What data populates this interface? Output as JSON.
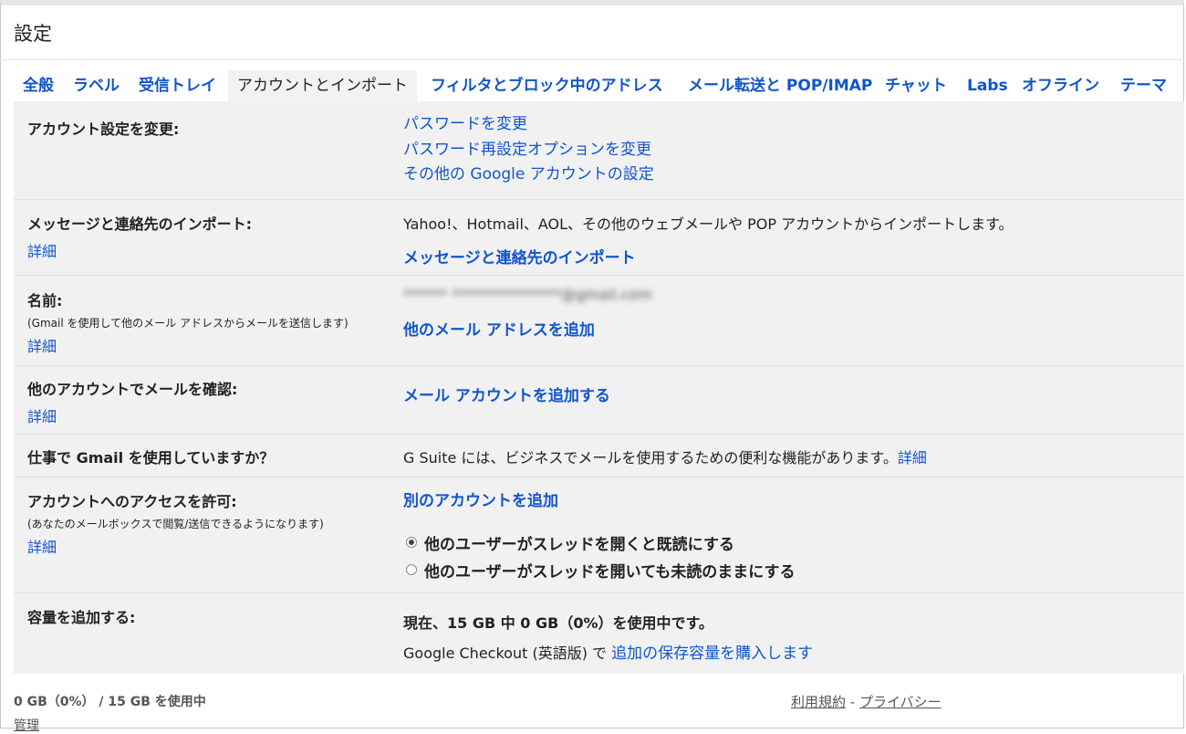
{
  "header": {
    "title": "設定"
  },
  "tabs": [
    {
      "label": "全般"
    },
    {
      "label": "ラベル"
    },
    {
      "label": "受信トレイ"
    },
    {
      "label": "アカウントとインポート",
      "active": true
    },
    {
      "label": "フィルタとブロック中のアドレス"
    },
    {
      "label": "メール転送と POP/IMAP"
    },
    {
      "label": "チャット"
    },
    {
      "label": "Labs"
    },
    {
      "label": "オフライン"
    },
    {
      "label": "テーマ"
    }
  ],
  "sections": {
    "account": {
      "label": "アカウント設定を変更:",
      "links": [
        "パスワードを変更",
        "パスワード再設定オプションを変更",
        "その他の Google アカウントの設定"
      ]
    },
    "import": {
      "label": "メッセージと連絡先のインポート:",
      "more": "詳細",
      "description": "Yahoo!、Hotmail、AOL、その他のウェブメールや POP アカウントからインポートします。",
      "action": "メッセージと連絡先のインポート"
    },
    "name": {
      "label": "名前:",
      "sub": "(Gmail を使用して他のメール アドレスからメールを送信します)",
      "more": "詳細",
      "value_blurred": "****** ***************@gmail.com",
      "action": "他のメール アドレスを追加"
    },
    "check_mail": {
      "label": "他のアカウントでメールを確認:",
      "more": "詳細",
      "action": "メール アカウントを追加する"
    },
    "work": {
      "label": "仕事で Gmail を使用していますか？",
      "description": "G Suite には、ビジネスでメールを使用するための便利な機能があります。",
      "more": "詳細"
    },
    "access": {
      "label": "アカウントへのアクセスを許可:",
      "sub": "(あなたのメールボックスで閲覧/送信できるようになります)",
      "more": "詳細",
      "action": "別のアカウントを追加",
      "options": [
        {
          "label": "他のユーザーがスレッドを開くと既読にする",
          "checked": true
        },
        {
          "label": "他のユーザーがスレッドを開いても未読のままにする",
          "checked": false
        }
      ]
    },
    "storage": {
      "label": "容量を追加する:",
      "usage": "現在、15 GB 中 0 GB（0%）を使用中です。",
      "checkout_prefix": "Google Checkout (英語版) で ",
      "checkout_link": "追加の保存容量を購入します"
    }
  },
  "footer": {
    "usage": "0 GB（0%） / 15 GB を使用中",
    "manage": "管理",
    "terms": "利用規約",
    "separator": " - ",
    "privacy": "プライバシー"
  }
}
